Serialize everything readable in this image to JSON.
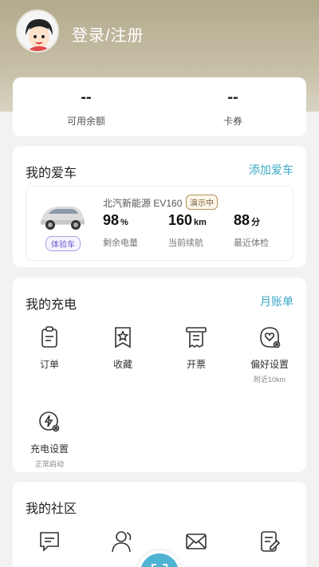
{
  "header": {
    "login_label": "登录/注册",
    "avatar_icon": "user-avatar-icon"
  },
  "balance": {
    "items": [
      {
        "value": "--",
        "label": "可用余额"
      },
      {
        "value": "--",
        "label": "卡券"
      }
    ]
  },
  "my_car": {
    "title": "我的爱车",
    "action": "添加爱车",
    "car": {
      "model": "北汽新能源 EV160",
      "demo_tag": "演示中",
      "trial_tag": "体验车",
      "stats": [
        {
          "value": "98",
          "unit": "%",
          "label": "剩余电量"
        },
        {
          "value": "160",
          "unit": "km",
          "label": "当前续航"
        },
        {
          "value": "88",
          "unit": "分",
          "label": "最近体检"
        }
      ]
    }
  },
  "my_charging": {
    "title": "我的充电",
    "action": "月账单",
    "items": [
      {
        "label": "订单",
        "icon": "clipboard-icon",
        "sub": ""
      },
      {
        "label": "收藏",
        "icon": "star-bookmark-icon",
        "sub": ""
      },
      {
        "label": "开票",
        "icon": "receipt-icon",
        "sub": ""
      },
      {
        "label": "偏好设置",
        "icon": "heart-settings-icon",
        "sub": "附近10km"
      },
      {
        "label": "充电设置",
        "icon": "lightning-settings-icon",
        "sub": "正常启动"
      }
    ]
  },
  "my_community": {
    "title": "我的社区",
    "items": [
      {
        "icon": "chat-icon"
      },
      {
        "icon": "users-icon"
      },
      {
        "icon": "mail-icon"
      },
      {
        "icon": "edit-note-icon"
      }
    ]
  },
  "fab": {
    "icon": "scan-icon"
  },
  "colors": {
    "accent": "#3aa9c7",
    "header": "#b3aa8d",
    "fab": "#4fb3d3"
  }
}
